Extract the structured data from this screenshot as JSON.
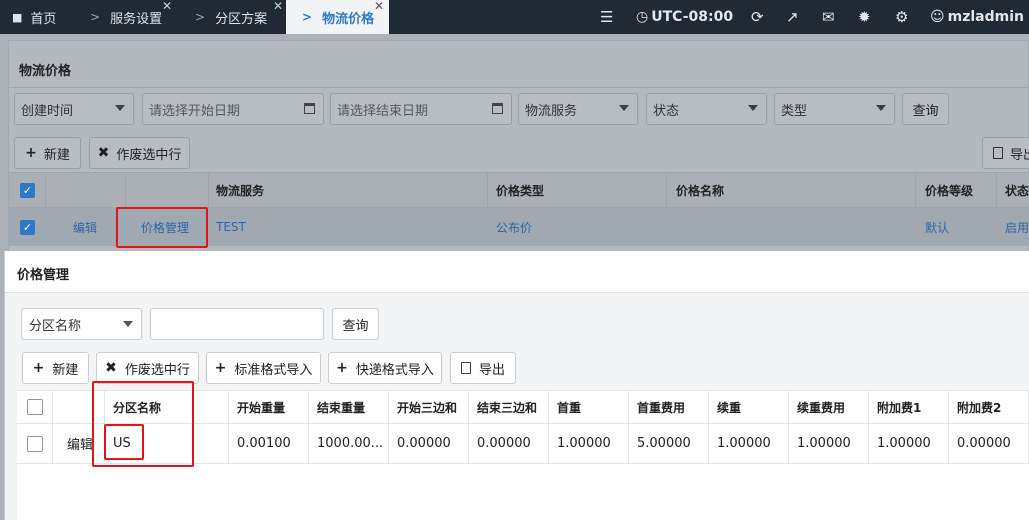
{
  "topbar": {
    "tabs": [
      {
        "label": "首页",
        "icon": "home-icon"
      },
      {
        "label": "服务设置",
        "closable": true
      },
      {
        "label": "分区方案",
        "closable": true
      },
      {
        "label": "物流价格",
        "closable": true,
        "active": true
      }
    ],
    "timezone": "UTC-08:00",
    "user": "mzladmin"
  },
  "page": {
    "title": "物流价格",
    "filters": {
      "time_type": "创建时间",
      "start_date_placeholder": "请选择开始日期",
      "end_date_placeholder": "请选择结束日期",
      "service": "物流服务",
      "status": "状态",
      "type": "类型",
      "query_label": "查询"
    },
    "toolbar": {
      "new_label": "新建",
      "void_label": "作废选中行",
      "export_label": "导出"
    },
    "table": {
      "headers": [
        "物流服务",
        "价格类型",
        "价格名称",
        "价格等级",
        "状态"
      ],
      "row": {
        "edit": "编辑",
        "manage": "价格管理",
        "service": "TEST",
        "price_type": "公布价",
        "price_level": "默认",
        "status": "启用"
      }
    }
  },
  "modal": {
    "title": "价格管理",
    "filter_select": "分区名称",
    "filter_input_value": "",
    "query_label": "查询",
    "toolbar": {
      "new_label": "新建",
      "void_label": "作废选中行",
      "std_import_label": "标准格式导入",
      "express_import_label": "快递格式导入",
      "export_label": "导出"
    },
    "table": {
      "headers": [
        "分区名称",
        "开始重量",
        "结束重量",
        "开始三边和",
        "结束三边和",
        "首重",
        "首重费用",
        "续重",
        "续重费用",
        "附加费1",
        "附加费2"
      ],
      "rows": [
        {
          "edit": "编辑",
          "values": [
            "US",
            "0.00100",
            "1000.00...",
            "0.00000",
            "0.00000",
            "1.00000",
            "5.00000",
            "1.00000",
            "1.00000",
            "1.00000",
            "0.00000"
          ]
        }
      ]
    }
  },
  "colors": {
    "accent": "#2e78c8",
    "highlight": "#e0161b",
    "topbar": "#1f2a35"
  }
}
